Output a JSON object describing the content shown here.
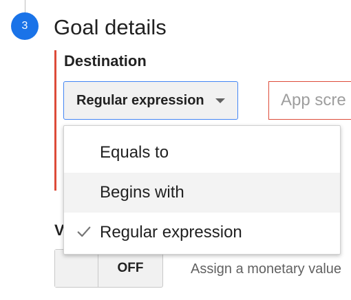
{
  "step": {
    "number": "3",
    "title": "Goal details",
    "accent_color": "#1a73e8"
  },
  "destination": {
    "label": "Destination",
    "match_type": "Regular expression",
    "input_placeholder": "App scre",
    "helper_text": "",
    "error_color": "#dd4b39"
  },
  "match_menu": {
    "options": [
      "Equals to",
      "Begins with",
      "Regular expression"
    ],
    "selected": "Regular expression",
    "highlighted": "Begins with"
  },
  "value": {
    "heading": "V",
    "toggle_label": "OFF",
    "description": "Assign a monetary value"
  },
  "icons": {
    "selected_marker": "check-icon",
    "select_caret": "caret-down-icon"
  }
}
